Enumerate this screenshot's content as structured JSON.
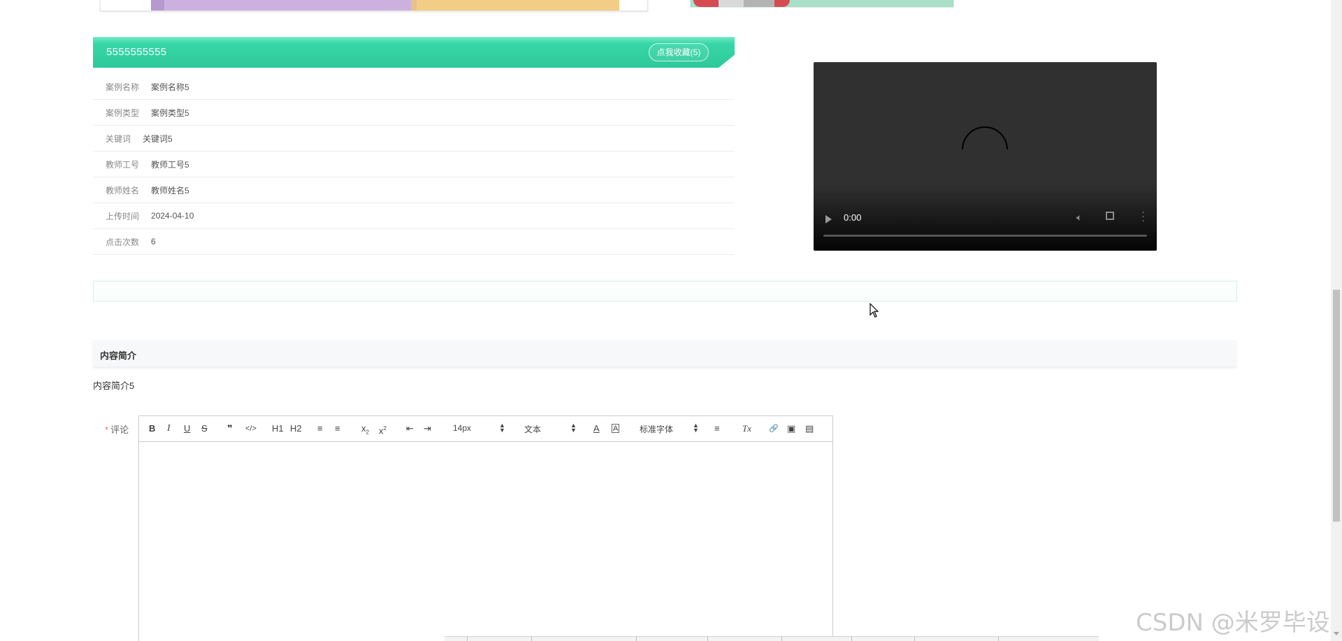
{
  "case": {
    "title": "5555555555",
    "favorite_button": "点我收藏(5)",
    "fields": [
      {
        "label": "案例名称",
        "value": "案例名称5"
      },
      {
        "label": "案例类型",
        "value": "案例类型5"
      },
      {
        "label": "关键词",
        "value": "关键词5"
      },
      {
        "label": "教师工号",
        "value": "教师工号5"
      },
      {
        "label": "教师姓名",
        "value": "教师姓名5"
      },
      {
        "label": "上传时间",
        "value": "2024-04-10"
      },
      {
        "label": "点击次数",
        "value": "6"
      }
    ]
  },
  "video": {
    "time": "0:00",
    "progress": 0
  },
  "intro": {
    "heading": "内容简介",
    "text": "内容简介5"
  },
  "comment": {
    "required_mark": "*",
    "label": "评论",
    "toolbar": {
      "bold": "B",
      "italic": "I",
      "underline": "U",
      "strike": "S",
      "blockquote": "❞",
      "code": "</>",
      "h1": "H1",
      "h2": "H2",
      "ordered_list": "≡",
      "bullet_list": "≡",
      "subscript": "x",
      "superscript": "x",
      "outdent": "⇤",
      "indent": "⇥",
      "font_size": "14px",
      "block_format": "文本",
      "font_color": "A",
      "background": "A",
      "font_family": "标准字体",
      "align": "≡",
      "clean": "Tx",
      "link": "🔗",
      "image": "▣",
      "video": "▤"
    },
    "value": ""
  },
  "watermark": "CSDN @米罗毕设",
  "colors": {
    "accent": "#2ec89a",
    "required": "#f56c6c"
  }
}
